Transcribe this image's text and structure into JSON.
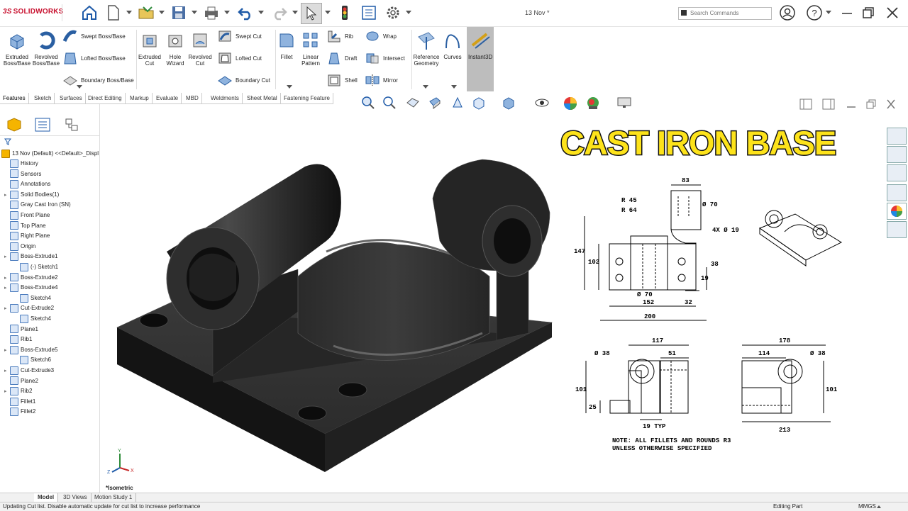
{
  "app": {
    "logo": "SOLIDWORKS",
    "doc_title": "13 Nov *"
  },
  "search": {
    "placeholder": "Search Commands"
  },
  "commands": {
    "extruded_boss": "Extruded Boss/Base",
    "revolved_boss": "Revolved Boss/Base",
    "swept_boss": "Swept Boss/Base",
    "lofted_boss": "Lofted Boss/Base",
    "boundary_boss": "Boundary Boss/Base",
    "extruded_cut": "Extruded Cut",
    "hole_wizard": "Hole Wizard",
    "revolved_cut": "Revolved Cut",
    "swept_cut": "Swept Cut",
    "lofted_cut": "Lofted Cut",
    "boundary_cut": "Boundary Cut",
    "fillet": "Fillet",
    "linear_pattern": "Linear Pattern",
    "rib": "Rib",
    "draft": "Draft",
    "shell": "Shell",
    "wrap": "Wrap",
    "intersect": "Intersect",
    "mirror": "Mirror",
    "reference_geometry": "Reference Geometry",
    "curves": "Curves",
    "instant3d": "Instant3D"
  },
  "tabs": [
    "Features",
    "Sketch",
    "Surfaces",
    "Direct Editing",
    "Markup",
    "Evaluate",
    "MBD",
    "Weldments",
    "Sheet Metal",
    "Fastening Feature"
  ],
  "tree": {
    "root": "13 Nov (Default) <<Default>_Displ",
    "items": [
      "History",
      "Sensors",
      "Annotations",
      "Solid Bodies(1)",
      "Gray Cast Iron (SN)",
      "Front Plane",
      "Top Plane",
      "Right Plane",
      "Origin",
      "Boss-Extrude1",
      "(-) Sketch1",
      "Boss-Extrude2",
      "Boss-Extrude4",
      "Sketch4",
      "Cut-Extrude2",
      "Sketch4",
      "Plane1",
      "Rib1",
      "Boss-Extrude5",
      "Sketch6",
      "Cut-Extrude3",
      "Plane2",
      "Rib2",
      "Fillet1",
      "Fillet2"
    ]
  },
  "overlay": {
    "title": "CAST IRON BASE"
  },
  "drawing": {
    "dims": {
      "d83": "83",
      "r45": "R 45",
      "r64": "R 64",
      "dia70": "Ø 70",
      "holes": "4X  Ø 19",
      "d147": "147",
      "d102": "102",
      "d38": "38",
      "d19": "19",
      "dia70b": "Ø 70",
      "d152": "152",
      "d32": "32",
      "d200": "200",
      "d117": "117",
      "dia38a": "Ø 38",
      "d51": "51",
      "d101a": "101",
      "d25": "25",
      "d19typ": "19 TYP",
      "d178": "178",
      "d114": "114",
      "dia38b": "Ø 38",
      "d101b": "101",
      "d213": "213"
    },
    "note_line1": "NOTE: ALL FILLETS AND ROUNDS R3",
    "note_line2": "UNLESS OTHERWISE SPECIFIED"
  },
  "view_label": "*Isometric",
  "bottom_tabs": [
    "Model",
    "3D Views",
    "Motion Study 1"
  ],
  "status": {
    "message": "Updating Cut list. Disable automatic update for cut list to increase performance",
    "mode": "Editing Part",
    "units": "MMGS"
  },
  "colors": {
    "accent": "#c8102e",
    "title_fill": "#fde31a",
    "part": "#2b2b2b"
  }
}
